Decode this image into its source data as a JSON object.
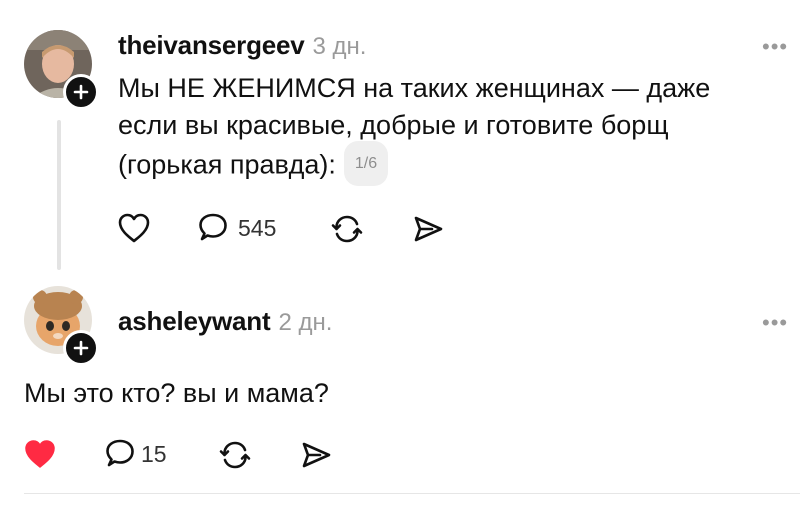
{
  "post": {
    "username": "theivansergeev",
    "time": "3 дн.",
    "more": "•••",
    "text_lines": [
      "Мы НЕ ЖЕНИМСЯ на таких женщинах — даже",
      "если вы красивые, добрые и готовите борщ",
      "(горькая правда):"
    ],
    "pager": "1/6",
    "actions": {
      "like_icon": "heart-outline-icon",
      "reply_icon": "comment-bubble-icon",
      "reply_count": "545",
      "repost_icon": "repost-icon",
      "share_icon": "share-send-icon"
    }
  },
  "reply": {
    "username": "asheleywant",
    "time": "2 дн.",
    "more": "•••",
    "text": "Мы это кто? вы и мама?",
    "actions": {
      "like_icon": "heart-filled-icon",
      "like_color": "#ff2a43",
      "reply_icon": "comment-bubble-icon",
      "reply_count": "15",
      "repost_icon": "repost-icon",
      "share_icon": "share-send-icon"
    }
  }
}
